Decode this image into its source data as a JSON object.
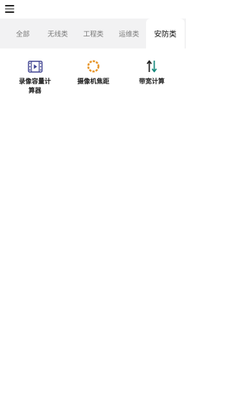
{
  "tabs": [
    {
      "label": "全部"
    },
    {
      "label": "无线类"
    },
    {
      "label": "工程类"
    },
    {
      "label": "运维类"
    },
    {
      "label": "安防类"
    }
  ],
  "active_tab": "安防类",
  "tools": [
    {
      "label": "录像容量计算器",
      "icon": "film-icon"
    },
    {
      "label": "摄像机焦距",
      "icon": "aperture-icon"
    },
    {
      "label": "带宽计算",
      "icon": "transfer-arrows-icon"
    }
  ],
  "colors": {
    "tab_bar_bg": "#f2f2f3",
    "film_icon": "#3b3f8f",
    "aperture_icon": "#e7962a",
    "arrows_up": "#222222",
    "arrows_down": "#1a8a7e"
  }
}
